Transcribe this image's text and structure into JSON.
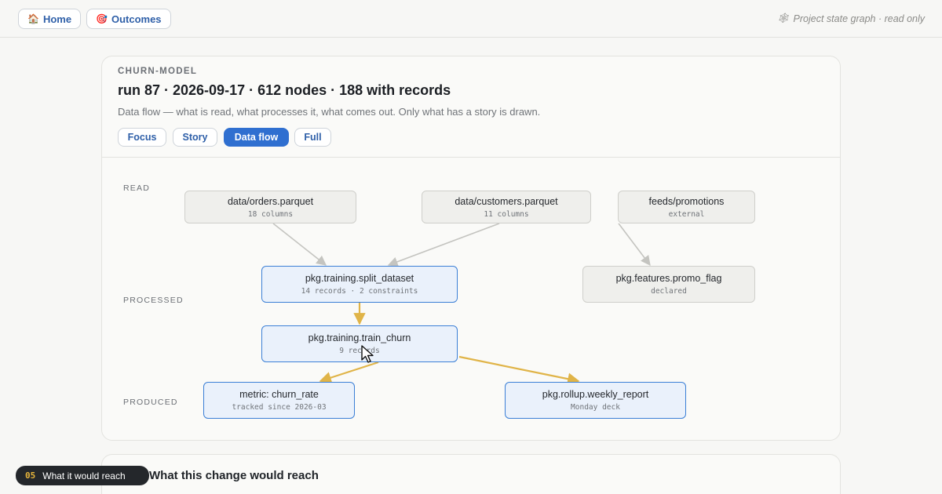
{
  "nav": {
    "home": {
      "icon": "🏠",
      "label": "Home"
    },
    "outcomes": {
      "icon": "🎯",
      "label": "Outcomes"
    },
    "state_icon": "🕸",
    "state_note": "Project state graph · read only"
  },
  "header": {
    "eyebrow": "CHURN-MODEL",
    "title": "run 87 · 2026-09-17 · 612 nodes · 188 with records",
    "description": "Data flow — what is read, what processes it, what comes out. Only what has a story is drawn."
  },
  "views": [
    {
      "label": "Focus",
      "active": false
    },
    {
      "label": "Story",
      "active": false
    },
    {
      "label": "Data flow",
      "active": true
    },
    {
      "label": "Full",
      "active": false
    }
  ],
  "lanes": {
    "read": "READ",
    "processed": "PROCESSED",
    "produced": "PRODUCED"
  },
  "nodes": {
    "orders": {
      "name": "data/orders.parquet",
      "sub": "18 columns"
    },
    "customers": {
      "name": "data/customers.parquet",
      "sub": "11 columns"
    },
    "promotions": {
      "name": "feeds/promotions",
      "sub": "external"
    },
    "split": {
      "name": "pkg.training.split_dataset",
      "sub": "14 records · 2 constraints"
    },
    "promo_flag": {
      "name": "pkg.features.promo_flag",
      "sub": "declared"
    },
    "train": {
      "name": "pkg.training.train_churn",
      "sub": "9 records"
    },
    "metric": {
      "name": "metric: churn_rate",
      "sub": "tracked since 2026-03"
    },
    "report": {
      "name": "pkg.rollup.weekly_report",
      "sub": "Monday deck"
    }
  },
  "colors": {
    "accent": "#2f6fd0",
    "edge_gray": "#c4c4c0",
    "edge_gold": "#e0b448"
  },
  "next_section": {
    "title": "What this change would reach"
  },
  "toast": {
    "number": "05",
    "label": "What it would reach"
  }
}
